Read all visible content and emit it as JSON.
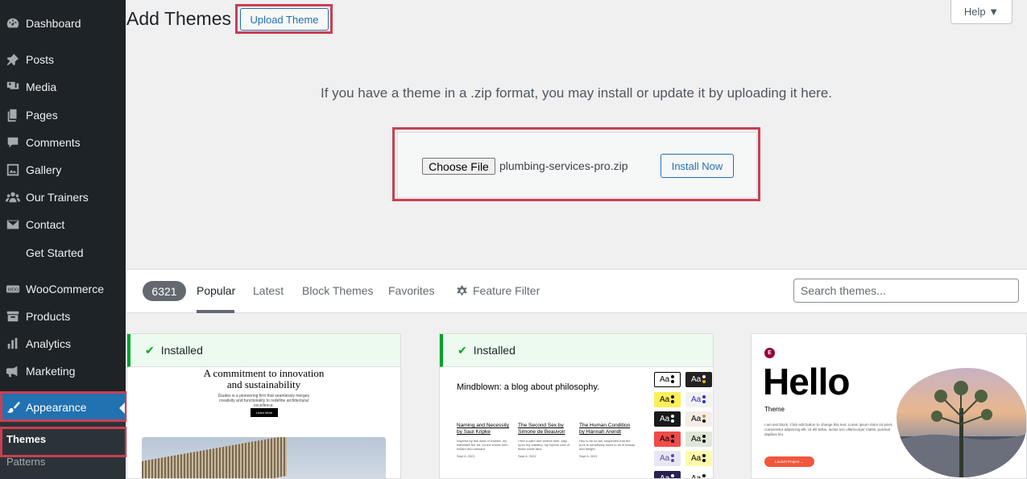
{
  "sidebar": {
    "items": [
      {
        "label": "Dashboard",
        "icon": "dashboard-icon"
      },
      {
        "label": "Posts",
        "icon": "pin-icon"
      },
      {
        "label": "Media",
        "icon": "media-icon"
      },
      {
        "label": "Pages",
        "icon": "pages-icon"
      },
      {
        "label": "Comments",
        "icon": "comment-icon"
      },
      {
        "label": "Gallery",
        "icon": "gallery-icon"
      },
      {
        "label": "Our Trainers",
        "icon": "groups-icon"
      },
      {
        "label": "Contact",
        "icon": "email-icon"
      },
      {
        "label": "Get Started",
        "icon": ""
      },
      {
        "label": "WooCommerce",
        "icon": "woo-icon"
      },
      {
        "label": "Products",
        "icon": "archive-icon"
      },
      {
        "label": "Analytics",
        "icon": "chart-bar-icon"
      },
      {
        "label": "Marketing",
        "icon": "megaphone-icon"
      },
      {
        "label": "Appearance",
        "icon": "paintbrush-icon"
      }
    ],
    "submenu": {
      "themes": "Themes",
      "patterns": "Patterns"
    }
  },
  "header": {
    "title": "Add Themes",
    "upload_button": "Upload Theme",
    "help": "Help ▼"
  },
  "upload": {
    "description": "If you have a theme in a .zip format, you may install or update it by uploading it here.",
    "choose_file": "Choose File",
    "file_name": "plumbing-services-pro.zip",
    "install_now": "Install Now"
  },
  "filter": {
    "count": "6321",
    "tabs": [
      "Popular",
      "Latest",
      "Block Themes",
      "Favorites"
    ],
    "feature_filter": "Feature Filter",
    "search_placeholder": "Search themes..."
  },
  "cards": [
    {
      "installed": "Installed",
      "preview": {
        "heading": "A commitment to innovation and sustainability",
        "body": "Études is a pioneering firm that seamlessly merges creativity and functionality to redefine architectural excellence.",
        "button": "Learn More"
      }
    },
    {
      "installed": "Installed",
      "preview": {
        "title": "Mindblown: a blog about philosophy.",
        "books": [
          {
            "title": "Naming and Necessity by Saul Kripke",
            "desc": "Inspired by this wind of wonder, my elaborate the art, for the words form inward and outward.",
            "date": "Sept 6, 2021"
          },
          {
            "title": "The Second Sex by Simone de Beauvoir",
            "desc": "I feel a calm and serene time, play upon my mastery, my hymns rose of these noble fans.",
            "date": "Sept 6, 2021"
          },
          {
            "title": "The Human Condition by Hannah Arendt",
            "desc": "Hey to be so tall, suspected that the pure is sensitively loved in all of beauty and delight.",
            "date": "Sept 6, 2021"
          }
        ],
        "swatch_label": "Aa"
      }
    },
    {
      "installed": "",
      "preview": {
        "logo": "E",
        "hello": "Hello",
        "theme": "Theme",
        "text": "I am text block. Click edit button to change this text. Lorem ipsum dolor sit amet, consectetur adipiscing elit. Ut elit tellus, luctus nec ullamcorper mattis, pulvinar dapibus leo.",
        "launch": "Launch Project →"
      }
    }
  ],
  "colors": {
    "accent": "#2271b1",
    "sidebar": "#1d2327",
    "highlight": "#c93f52",
    "installed": "#00a32a"
  }
}
